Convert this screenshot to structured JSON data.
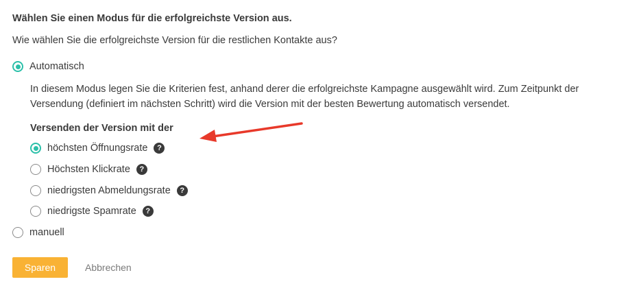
{
  "form": {
    "heading": "Wählen Sie einen Modus für die erfolgreichste Version aus.",
    "question": "Wie wählen Sie die erfolgreichste Version für die restlichen Kontakte aus?",
    "mode_auto": {
      "label": "Automatisch",
      "checked": true
    },
    "description": "In diesem Modus legen Sie die Kriterien fest, anhand derer die erfolgreichste Kampagne ausgewählt wird. Zum Zeitpunkt der Versendung (definiert im nächsten Schritt) wird die Version mit der besten Bewertung automatisch versendet.",
    "criteria_heading": "Versenden der Version mit der",
    "criteria": [
      {
        "label": "höchsten Öffnungsrate",
        "checked": true
      },
      {
        "label": "Höchsten Klickrate",
        "checked": false
      },
      {
        "label": "niedrigsten Abmeldungsrate",
        "checked": false
      },
      {
        "label": "niedrigste Spamrate",
        "checked": false
      }
    ],
    "mode_manual": {
      "label": "manuell",
      "checked": false
    },
    "help_glyph": "?"
  },
  "actions": {
    "save_label": "Sparen",
    "cancel_label": "Abbrechen"
  },
  "colors": {
    "accent": "#2bc0a9",
    "save_button": "#f9b234",
    "arrow": "#e8392a"
  },
  "icons": {
    "help": "question-circle-icon",
    "annotation": "red-arrow-icon"
  }
}
